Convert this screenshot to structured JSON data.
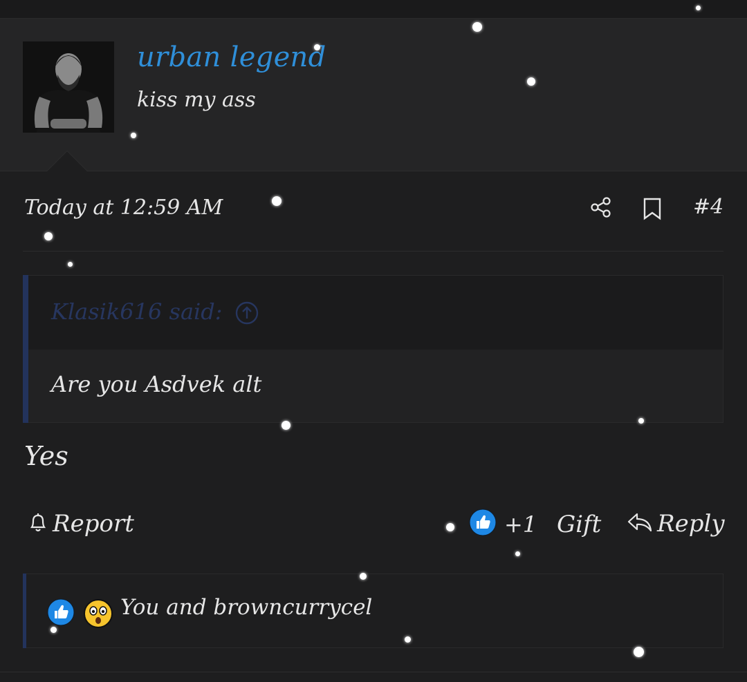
{
  "user": {
    "name": "urban legend",
    "title": "kiss my ass",
    "avatar_icon": "avatar-photo"
  },
  "post": {
    "timestamp": "Today at 12:59 AM",
    "number": "#4",
    "share_icon": "share-icon",
    "bookmark_icon": "bookmark-icon"
  },
  "quote": {
    "author": "Klasik616 said:",
    "text": "Are you Asdvek alt"
  },
  "message": "Yes",
  "actions": {
    "report": "Report",
    "like_count": "+1",
    "gift": "Gift",
    "reply": "Reply"
  },
  "reactions": {
    "summary": "You and browncurrycel",
    "icons": [
      "like-icon",
      "wow-emoji-icon"
    ]
  },
  "colors": {
    "background": "#1e1e1f",
    "username": "#2f8fd9",
    "quote_accent": "#23335c",
    "like_blue": "#1e88e5"
  }
}
